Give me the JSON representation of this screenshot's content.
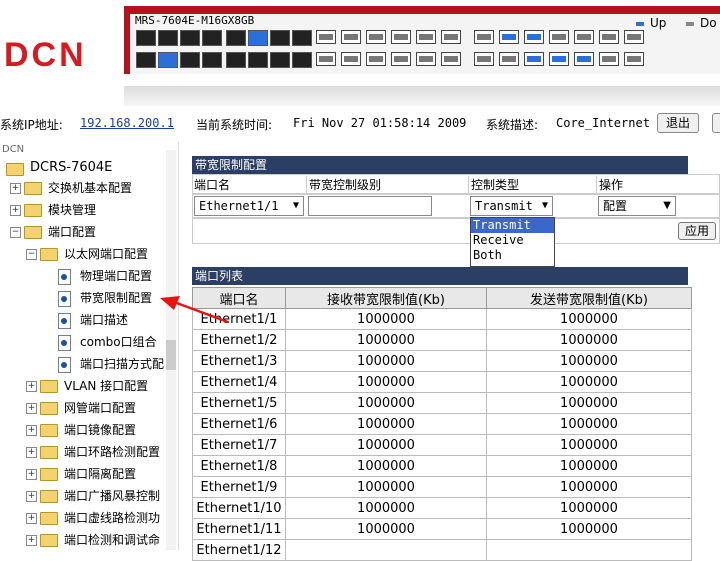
{
  "header": {
    "logo_text": "DCN",
    "device_model": "MRS-7604E-M16GX8GB",
    "legend_up": "Up",
    "legend_down": "Do"
  },
  "infobar": {
    "ip_label": "系统IP地址:",
    "ip_value": "192.168.200.1",
    "time_label": "当前系统时间:",
    "time_value": "Fri Nov 27 01:58:14 2009",
    "desc_label": "系统描述:",
    "desc_value": "Core_Internet",
    "logout_label": "退出"
  },
  "sidebar": {
    "root_small": "DCN",
    "root": "DCRS-7604E",
    "items": [
      {
        "label": "交换机基本配置"
      },
      {
        "label": "模块管理"
      },
      {
        "label": "端口配置"
      },
      {
        "label": "以太网端口配置"
      },
      {
        "label": "物理端口配置"
      },
      {
        "label": "带宽限制配置"
      },
      {
        "label": "端口描述"
      },
      {
        "label": "combo口组合"
      },
      {
        "label": "端口扫描方式配"
      },
      {
        "label": "VLAN 接口配置"
      },
      {
        "label": "网管端口配置"
      },
      {
        "label": "端口镜像配置"
      },
      {
        "label": "端口环路检测配置"
      },
      {
        "label": "端口隔离配置"
      },
      {
        "label": "端口广播风暴控制"
      },
      {
        "label": "端口虚线路检测功"
      },
      {
        "label": "端口检测和调试命"
      }
    ]
  },
  "bandwidth_panel": {
    "title": "带宽限制配置",
    "col_port": "端口名",
    "col_level": "带宽控制级别",
    "col_type": "控制类型",
    "col_action": "操作",
    "port_value": "Ethernet1/1",
    "level_value": "",
    "type_value": "Transmit",
    "action_value": "配置",
    "type_options": [
      "Transmit",
      "Receive",
      "Both"
    ],
    "apply_label": "应用"
  },
  "port_list": {
    "title": "端口列表",
    "headers": [
      "端口名",
      "接收带宽限制值(Kb)",
      "发送带宽限制值(Kb)"
    ],
    "rows": [
      [
        "Ethernet1/1",
        "1000000",
        "1000000"
      ],
      [
        "Ethernet1/2",
        "1000000",
        "1000000"
      ],
      [
        "Ethernet1/3",
        "1000000",
        "1000000"
      ],
      [
        "Ethernet1/4",
        "1000000",
        "1000000"
      ],
      [
        "Ethernet1/5",
        "1000000",
        "1000000"
      ],
      [
        "Ethernet1/6",
        "1000000",
        "1000000"
      ],
      [
        "Ethernet1/7",
        "1000000",
        "1000000"
      ],
      [
        "Ethernet1/8",
        "1000000",
        "1000000"
      ],
      [
        "Ethernet1/9",
        "1000000",
        "1000000"
      ],
      [
        "Ethernet1/10",
        "1000000",
        "1000000"
      ],
      [
        "Ethernet1/11",
        "1000000",
        "1000000"
      ],
      [
        "Ethernet1/12",
        "",
        ""
      ]
    ]
  },
  "colors": {
    "brand": "#d71920",
    "panel_header": "#2b3e63",
    "port_up": "#2b6fd8"
  }
}
